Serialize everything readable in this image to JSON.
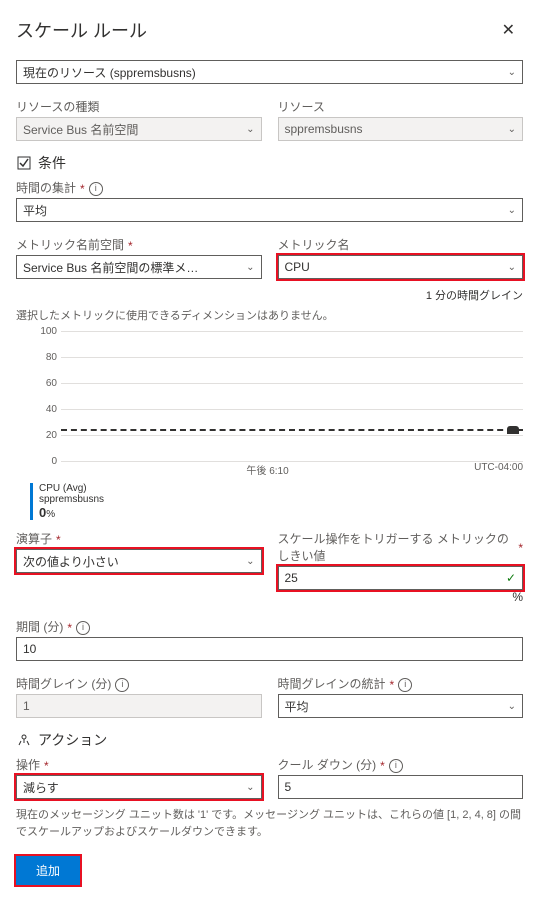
{
  "header": {
    "title": "スケール ルール"
  },
  "resource_scope": {
    "label": "現在のリソース (sppremsbusns)"
  },
  "resource_type": {
    "label": "リソースの種類",
    "value": "Service Bus 名前空間"
  },
  "resource": {
    "label": "リソース",
    "value": "sppremsbusns"
  },
  "criteria_section": "条件",
  "time_agg": {
    "label": "時間の集計",
    "value": "平均"
  },
  "metric_ns": {
    "label": "メトリック名前空間",
    "value": "Service  Bus 名前空間の標準メ…"
  },
  "metric_name": {
    "label": "メトリック名",
    "value": "CPU"
  },
  "time_grain_note": "1 分の時間グレイン",
  "dimension_note": "選択したメトリックに使用できるディメンションはありません。",
  "chart_data": {
    "type": "line",
    "ylim": [
      0,
      100
    ],
    "y_ticks": [
      0,
      20,
      40,
      60,
      80,
      100
    ],
    "threshold": 25,
    "x_center_label": "午後 6:10",
    "tz_label": "UTC-04:00",
    "legend": {
      "name": "CPU (Avg)",
      "resource": "sppremsbusns",
      "value": "0",
      "unit": "%"
    }
  },
  "operator": {
    "label": "演算子",
    "value": "次の値より小さい"
  },
  "threshold": {
    "label": "スケール操作をトリガーする メトリックのしきい値",
    "value": "25",
    "unit": "%"
  },
  "duration": {
    "label": "期間 (分)",
    "value": "10"
  },
  "time_grain": {
    "label": "時間グレイン (分)",
    "value": "1"
  },
  "time_grain_stat": {
    "label": "時間グレインの統計",
    "value": "平均"
  },
  "action_section": "アクション",
  "operation": {
    "label": "操作",
    "value": "減らす"
  },
  "cooldown": {
    "label": "クール ダウン (分)",
    "value": "5"
  },
  "foot_note": "現在のメッセージング ユニット数は '1' です。メッセージング ユニットは、これらの値 [1, 2, 4, 8] の間でスケールアップおよびスケールダウンできます。",
  "add_btn": "追加"
}
